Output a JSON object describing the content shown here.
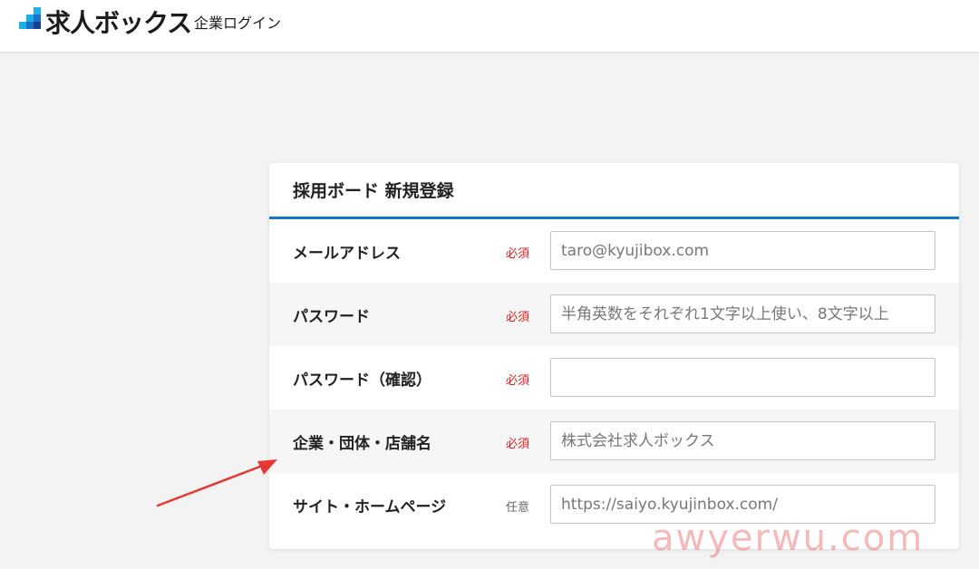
{
  "header": {
    "logo_text": "求人ボックス",
    "subtitle": "企業ログイン"
  },
  "card": {
    "title": "採用ボード 新規登録",
    "accent_color": "#1a73c9",
    "rows": [
      {
        "label": "メールアドレス",
        "badge": "必須",
        "placeholder": "taro@kyujibox.com",
        "value": ""
      },
      {
        "label": "パスワード",
        "badge": "必須",
        "placeholder": "半角英数をそれぞれ1文字以上使い、8文字以上",
        "value": ""
      },
      {
        "label": "パスワード（確認）",
        "badge": "必須",
        "placeholder": "",
        "value": ""
      },
      {
        "label": "企業・団体・店舗名",
        "badge": "必須",
        "placeholder": "株式会社求人ボックス",
        "value": ""
      },
      {
        "label": "サイト・ホームページ",
        "badge": "任意",
        "placeholder": "https://saiyo.kyujinbox.com/",
        "value": ""
      }
    ]
  },
  "colors": {
    "required": "#d21f1f",
    "optional": "#666666",
    "arrow": "#e53935"
  },
  "watermark": "awyerwu.com",
  "icons": [
    "logo-icon",
    "pointer-arrow-icon"
  ]
}
